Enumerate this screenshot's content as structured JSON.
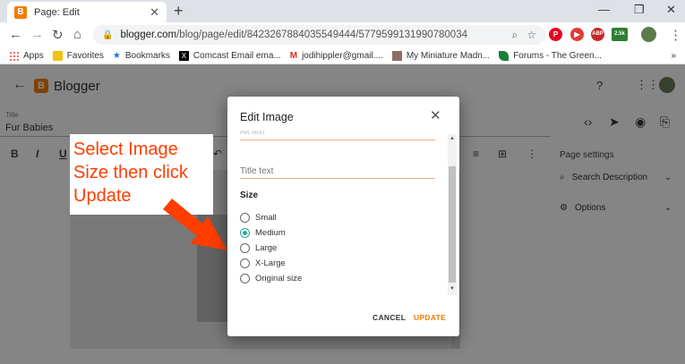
{
  "browser": {
    "tab_title": "Page: Edit",
    "tab_close": "✕",
    "new_tab": "+",
    "url_host": "blogger.com",
    "url_path": "/blog/page/edit/8423267884035549444/5779599131990780034",
    "ext_badge": "2.5k",
    "ext_abp": "ABP"
  },
  "bookmarks": [
    {
      "label": "Apps",
      "icon": "apps-grid-icon",
      "color": "#ea4335"
    },
    {
      "label": "Favorites",
      "icon": "folder-icon",
      "color": "#f4c20d"
    },
    {
      "label": "Bookmarks",
      "icon": "star-icon",
      "color": "#1a73e8"
    },
    {
      "label": "Comcast Email ema...",
      "icon": "x-icon",
      "color": "#000000"
    },
    {
      "label": "jodihippler@gmail....",
      "icon": "gmail-icon",
      "color": "#d93025"
    },
    {
      "label": "My Miniature Madn...",
      "icon": "image-icon",
      "color": "#8d6e63"
    },
    {
      "label": "Forums - The Green...",
      "icon": "leaf-icon",
      "color": "#188038"
    }
  ],
  "blogger": {
    "app_name": "Blogger",
    "logo_letter": "B",
    "title_label": "Title",
    "title_value": "Fur Babies",
    "page_settings": "Page settings",
    "search_description": "Search Description",
    "options": "Options"
  },
  "callout": {
    "text": "Select Image Size then click Update",
    "color": "#ff3d00"
  },
  "dialog": {
    "title": "Edit Image",
    "alt_text_fragment": "Alt text",
    "title_placeholder": "Title text",
    "size_label": "Size",
    "options": [
      {
        "label": "Small",
        "selected": false
      },
      {
        "label": "Medium",
        "selected": true
      },
      {
        "label": "Large",
        "selected": false
      },
      {
        "label": "X-Large",
        "selected": false
      },
      {
        "label": "Original size",
        "selected": false
      }
    ],
    "cancel": "CANCEL",
    "update": "UPDATE",
    "accent": "#26a69a",
    "update_color": "#f57c00"
  }
}
